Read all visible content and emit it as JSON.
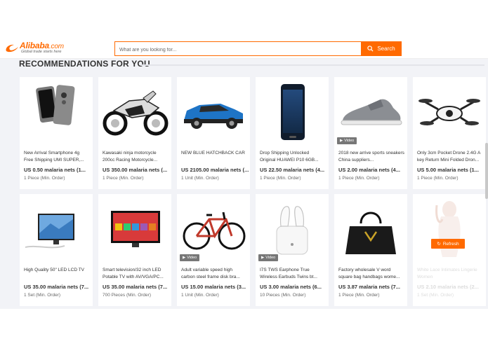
{
  "header": {
    "logo_brand": "Alibaba",
    "logo_suffix": ".com",
    "logo_tagline": "Global trade starts here",
    "search_placeholder": "What are you looking for...",
    "search_button": "Search"
  },
  "section": {
    "title": "RECOMMENDATIONS FOR YOU"
  },
  "products": [
    {
      "name": "New Arrival Smartphone 4g Free Shipping UMI SUPER,...",
      "price": "US 0.50 malaria nets (1...",
      "moq": "1 Piece (Min. Order)",
      "icon": "smartphone-image",
      "video": false
    },
    {
      "name": "Kawasaki ninja motorcycle 200cc Racing Motorcycle...",
      "price": "US 350.00 malaria nets (...",
      "moq": "1 Piece (Min. Order)",
      "icon": "motorcycle-image",
      "video": false
    },
    {
      "name": "NEW BLUE HATCHBACK CAR",
      "price": "US 2105.00 malaria nets (...",
      "moq": "1 Unit (Min. Order)",
      "icon": "car-image",
      "video": false
    },
    {
      "name": "Drop Shipping Unlocked Original HUAWEI P10 6GB...",
      "price": "US 22.50 malaria nets (4...",
      "moq": "1 Piece (Min. Order)",
      "icon": "phone-image",
      "video": false
    },
    {
      "name": "2018 new arrive sports sneakers China suppliers...",
      "price": "US 2.00 malaria nets (4...",
      "moq": "1 Piece (Min. Order)",
      "icon": "sneaker-image",
      "video": true
    },
    {
      "name": "Only 3cm Pocket Drone 2.4G A key Return Mini Folded Dron...",
      "price": "US 5.00 malaria nets (1...",
      "moq": "1 Piece (Min. Order)",
      "icon": "drone-image",
      "video": false
    },
    {
      "name": "High Quality 50\" LED LCD TV",
      "price": "US 35.00 malaria nets (7...",
      "moq": "1 Set (Min. Order)",
      "icon": "led-tv-image",
      "video": false
    },
    {
      "name": "Smart television/32 inch LED Potable TV with AV/VGA/PC...",
      "price": "US 35.00 malaria nets (7...",
      "moq": "700 Pieces (Min. Order)",
      "icon": "smart-tv-image",
      "video": false
    },
    {
      "name": "Adult variable speed high carbon steel frame disk bra...",
      "price": "US 15.00 malaria nets (3...",
      "moq": "1 Unit (Min. Order)",
      "icon": "bicycle-image",
      "video": true
    },
    {
      "name": "I7S TWS Earphone True Wireless Earbuds Twins bt...",
      "price": "US 3.00 malaria nets (6...",
      "moq": "10 Pieces (Min. Order)",
      "icon": "earbuds-image",
      "video": true
    },
    {
      "name": "Factory wholesale V word square bag handbags wome...",
      "price": "US 3.87 malaria nets (7...",
      "moq": "1 Piece (Min. Order)",
      "icon": "handbag-image",
      "video": false
    },
    {
      "name": "White Lace Intimates Lingerie Women",
      "price": "US 2.10 malaria nets (2...",
      "moq": "1 Set (Min. Order)",
      "icon": "lingerie-image",
      "video": false
    }
  ],
  "video_label": "Video",
  "refresh_label": "Refresh",
  "colors": {
    "accent": "#ff6a00",
    "background": "#f2f3f7"
  }
}
